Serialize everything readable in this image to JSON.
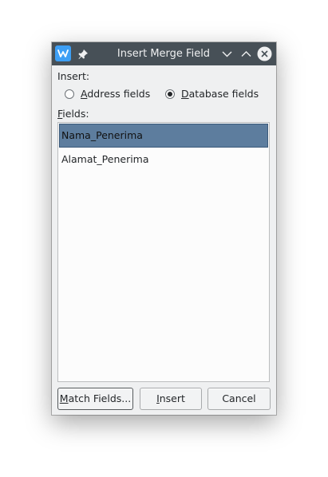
{
  "window": {
    "title": "Insert Merge Field"
  },
  "insert_group": {
    "label": "Insert:",
    "options": [
      {
        "mnemonic": "A",
        "rest": "ddress fields",
        "checked": false
      },
      {
        "mnemonic": "D",
        "rest": "atabase fields",
        "checked": true
      }
    ]
  },
  "fields_group": {
    "mnemonic": "F",
    "label_rest": "ields:",
    "items": [
      {
        "label": "Nama_Penerima",
        "selected": true
      },
      {
        "label": "Alamat_Penerima",
        "selected": false
      }
    ]
  },
  "buttons": {
    "match_mnemonic": "M",
    "match_rest": "atch Fields...",
    "insert_mnemonic": "I",
    "insert_rest": "nsert",
    "cancel": "Cancel"
  },
  "colors": {
    "titlebar": "#475057",
    "selection": "#5d7d9e",
    "app_icon": "#3d9ff5"
  },
  "icons": {
    "app": "writer-app-icon",
    "pin": "pin-icon",
    "minimize": "chevron-down-icon",
    "maximize": "chevron-up-icon",
    "close": "close-icon"
  }
}
